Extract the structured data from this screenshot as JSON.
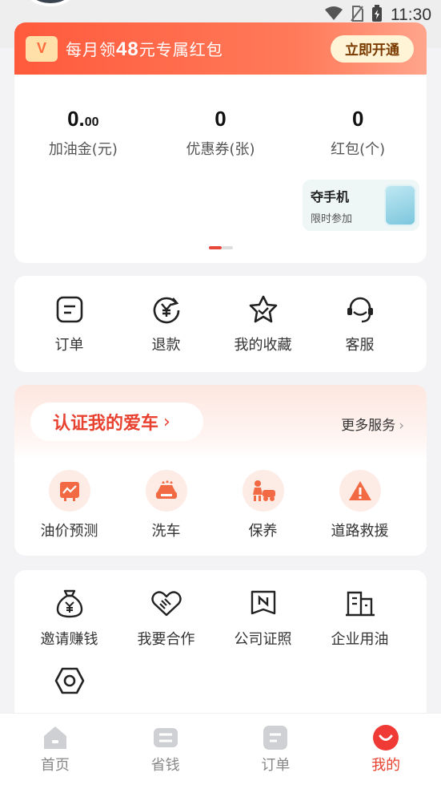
{
  "status_bar": {
    "time": "11:30"
  },
  "vip": {
    "text_prefix": "每月领",
    "amount": "48",
    "text_suffix": "元专属红包",
    "button": "立即开通"
  },
  "stats": [
    {
      "value_main": "0.",
      "value_small": "00",
      "label": "加油金(元)"
    },
    {
      "value_main": "0",
      "value_small": "",
      "label": "优惠券(张)"
    },
    {
      "value_main": "0",
      "value_small": "",
      "label": "红包(个)"
    }
  ],
  "promo": {
    "title": "夺手机",
    "subtitle": "限时参加"
  },
  "orders_row": [
    {
      "label": "订单",
      "icon": "order-icon"
    },
    {
      "label": "退款",
      "icon": "refund-icon"
    },
    {
      "label": "我的收藏",
      "icon": "favorites-icon"
    },
    {
      "label": "客服",
      "icon": "customer-service-icon"
    }
  ],
  "car": {
    "pill": "认证我的爱车",
    "more": "更多服务"
  },
  "services": [
    {
      "label": "油价预测",
      "icon": "oil-price-chart-icon"
    },
    {
      "label": "洗车",
      "icon": "car-wash-icon"
    },
    {
      "label": "保养",
      "icon": "maintenance-icon"
    },
    {
      "label": "道路救援",
      "icon": "road-rescue-icon"
    }
  ],
  "tools": [
    {
      "label": "邀请赚钱",
      "icon": "money-bag-icon"
    },
    {
      "label": "我要合作",
      "icon": "handshake-icon"
    },
    {
      "label": "公司证照",
      "icon": "certificate-icon"
    },
    {
      "label": "企业用油",
      "icon": "building-icon"
    }
  ],
  "tabbar": [
    {
      "label": "首页",
      "icon": "home-icon"
    },
    {
      "label": "省钱",
      "icon": "save-money-icon"
    },
    {
      "label": "订单",
      "icon": "order-tab-icon"
    },
    {
      "label": "我的",
      "icon": "profile-icon"
    }
  ],
  "colors": {
    "accent": "#e8412f",
    "banner": "#ff5a3c"
  }
}
